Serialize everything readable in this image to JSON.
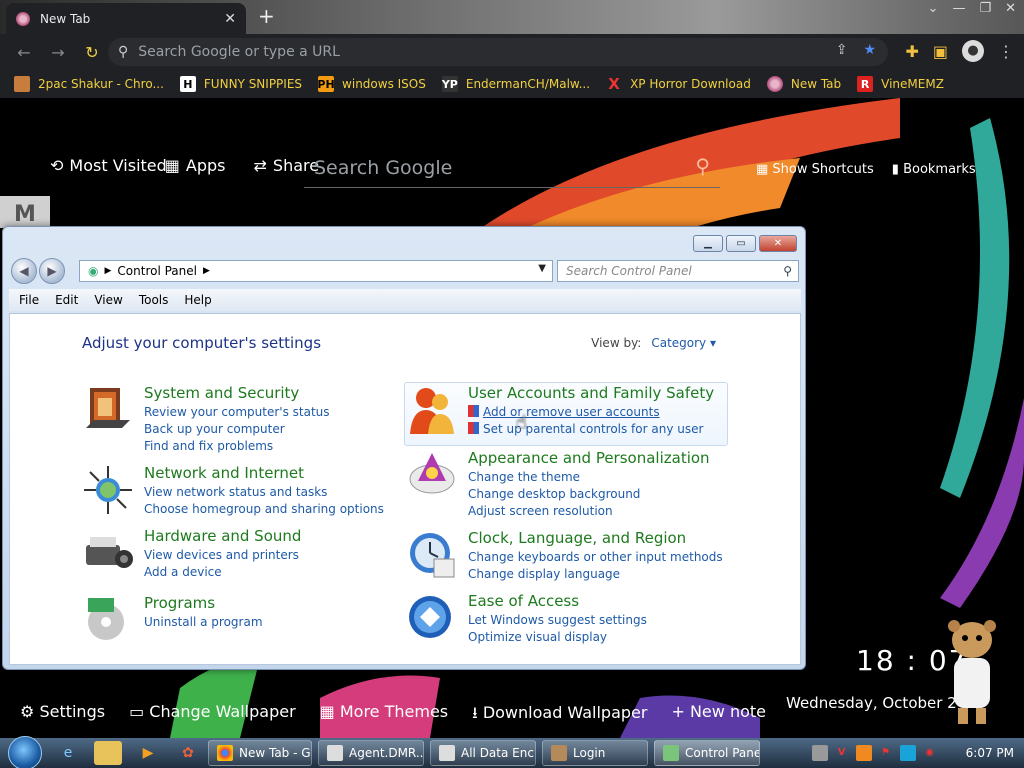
{
  "chrome": {
    "tab_title": "New Tab",
    "tab_close": "✕",
    "new_tab": "+",
    "omnibox_placeholder": "Search Google or type a URL",
    "bookmarks": [
      {
        "label": "2pac Shakur - Chro...",
        "icon_color": "#c77e3c"
      },
      {
        "label": "FUNNY SNIPPIES",
        "icon_text": "H"
      },
      {
        "label": "windows ISOS",
        "icon_text": "PH"
      },
      {
        "label": "EndermanCH/Malw...",
        "icon_text": "YP"
      },
      {
        "label": "XP Horror Download",
        "icon_text": "X"
      },
      {
        "label": "New Tab"
      },
      {
        "label": "VineMEMZ",
        "icon_text": "R"
      }
    ]
  },
  "ntp": {
    "most_visited": "Most Visited",
    "apps": "Apps",
    "share": "Share",
    "search_placeholder": "Search Google",
    "show_shortcuts": "Show Shortcuts",
    "bookmarks": "Bookmarks",
    "clock": "18 : 07",
    "date": "Wednesday, October 2",
    "bottom": {
      "settings": "Settings",
      "change_wallpaper": "Change Wallpaper",
      "more_themes": "More Themes",
      "download_wallpaper": "Download Wallpaper",
      "new_note": "+ New note"
    }
  },
  "explorer": {
    "address": "Control Panel",
    "search_placeholder": "Search Control Panel",
    "menus": [
      "File",
      "Edit",
      "View",
      "Tools",
      "Help"
    ],
    "heading": "Adjust your computer's settings",
    "view_by_label": "View by:",
    "view_by_value": "Category ▾",
    "categories": {
      "system": {
        "title": "System and Security",
        "links": [
          "Review your computer's status",
          "Back up your computer",
          "Find and fix problems"
        ]
      },
      "network": {
        "title": "Network and Internet",
        "links": [
          "View network status and tasks",
          "Choose homegroup and sharing options"
        ]
      },
      "hardware": {
        "title": "Hardware and Sound",
        "links": [
          "View devices and printers",
          "Add a device"
        ]
      },
      "programs": {
        "title": "Programs",
        "links": [
          "Uninstall a program"
        ]
      },
      "users": {
        "title": "User Accounts and Family Safety",
        "links": [
          "Add or remove user accounts",
          "Set up parental controls for any user"
        ]
      },
      "appearance": {
        "title": "Appearance and Personalization",
        "links": [
          "Change the theme",
          "Change desktop background",
          "Adjust screen resolution"
        ]
      },
      "clock": {
        "title": "Clock, Language, and Region",
        "links": [
          "Change keyboards or other input methods",
          "Change display language"
        ]
      },
      "ease": {
        "title": "Ease of Access",
        "links": [
          "Let Windows suggest settings",
          "Optimize visual display"
        ]
      }
    }
  },
  "taskbar": {
    "windows": [
      "New Tab - G...",
      "Agent.DMR...",
      "All Data Enc...",
      "Login",
      "Control Panel"
    ],
    "time": "6:07 PM"
  }
}
